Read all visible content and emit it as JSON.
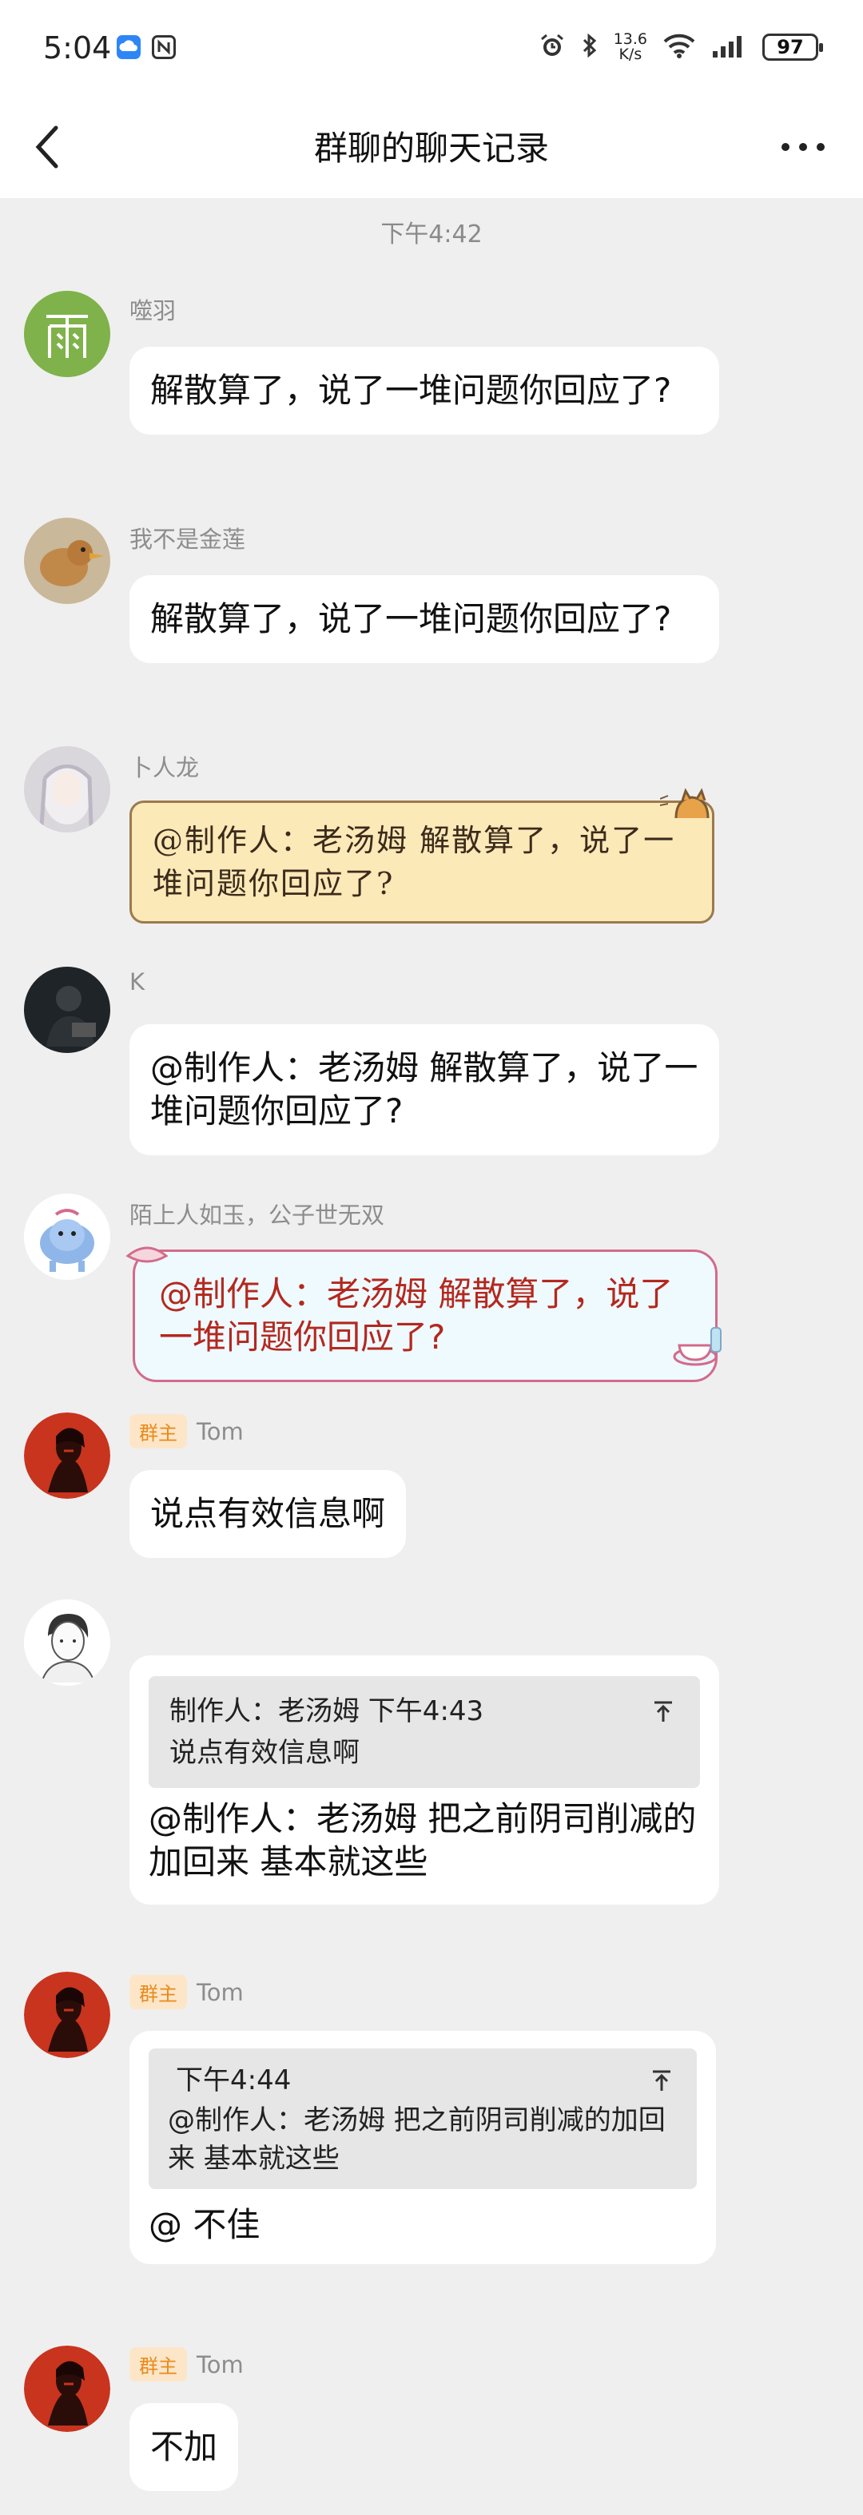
{
  "status_bar": {
    "time": "5:04",
    "net_speed_value": "13.6",
    "net_speed_unit": "K/s",
    "battery": "97"
  },
  "nav": {
    "title": "群聊的聊天记录"
  },
  "chat": {
    "timestamp": "下午4:42",
    "messages": [
      {
        "sender": "噬羽",
        "text": "解散算了，说了一堆问题你回应了?"
      },
      {
        "sender": "我不是金莲",
        "text": "解散算了，说了一堆问题你回应了?"
      },
      {
        "sender": "卜人龙",
        "text": "@制作人：老汤姆 解散算了，说了一堆问题你回应了?"
      },
      {
        "sender": "K",
        "text": "@制作人：老汤姆 解散算了，说了一堆问题你回应了?"
      },
      {
        "sender": "陌上人如玉，公子世无双",
        "text": "@制作人：老汤姆 解散算了，说了一堆问题你回应了?"
      },
      {
        "badge": "群主",
        "sender": "Tom",
        "text": "说点有效信息啊"
      },
      {
        "sender": "",
        "quote_header": "制作人：老汤姆 下午4:43",
        "quote_text": "说点有效信息啊",
        "text": "@制作人：老汤姆 把之前阴司削减的加回来  基本就这些"
      },
      {
        "badge": "群主",
        "sender": "Tom",
        "quote_header": "下午4:44",
        "quote_text": "@制作人：老汤姆 把之前阴司削减的加回来  基本就这些",
        "text": "@ 不佳"
      },
      {
        "badge": "群主",
        "sender": "Tom",
        "text": "不加"
      }
    ]
  },
  "colors": {
    "background": "#efefef",
    "bubble": "#ffffff",
    "owner_badge_bg": "#fde6c8",
    "owner_badge_text": "#e98a1d",
    "paper_bubble": "#fbe9b8",
    "pink_bubble_text": "#b4281f"
  }
}
